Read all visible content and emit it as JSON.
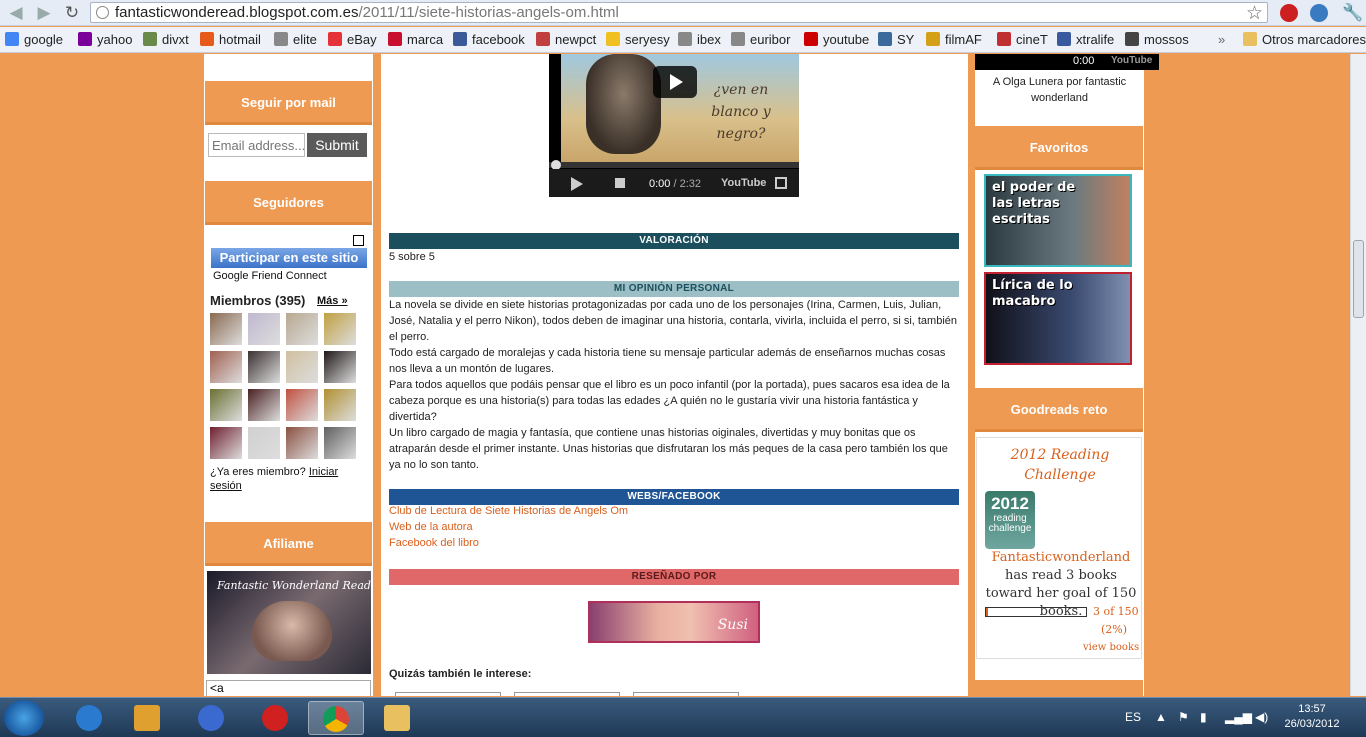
{
  "browser": {
    "url_host": "fantasticwonderead.blogspot.com.es",
    "url_path": "/2011/11/siete-historias-angels-om.html",
    "bookmarks": [
      {
        "label": "google",
        "color": "#4285f4"
      },
      {
        "label": "yahoo",
        "color": "#7b0099"
      },
      {
        "label": "divxt",
        "color": "#6a8a4a"
      },
      {
        "label": "hotmail",
        "color": "#e85a1a"
      },
      {
        "label": "elite",
        "color": "#888888"
      },
      {
        "label": "eBay",
        "color": "#e53238"
      },
      {
        "label": "marca",
        "color": "#c8102e"
      },
      {
        "label": "facebook",
        "color": "#3b5998"
      },
      {
        "label": "newpct",
        "color": "#c04040"
      },
      {
        "label": "seryesy",
        "color": "#f0c020"
      },
      {
        "label": "ibex",
        "color": "#888888"
      },
      {
        "label": "euribor",
        "color": "#888888"
      },
      {
        "label": "youtube",
        "color": "#cc0000"
      },
      {
        "label": "SY",
        "color": "#3a6a9a"
      },
      {
        "label": "filmAF",
        "color": "#d4a017"
      },
      {
        "label": "cineT",
        "color": "#c03030"
      },
      {
        "label": "xtralife",
        "color": "#3a5aa0"
      },
      {
        "label": "mossos",
        "color": "#444444"
      }
    ],
    "other_bookmarks": "Otros marcadores"
  },
  "left": {
    "seguir_title": "Seguir por mail",
    "email_placeholder": "Email address...",
    "submit": "Submit",
    "seguidores_title": "Seguidores",
    "gfc_button": "Participar en este sitio",
    "gfc_caption": "Google Friend Connect",
    "members_label": "Miembros (395)",
    "mas": "Más »",
    "member_question": "¿Ya eres miembro?",
    "login": "Iniciar sesión",
    "afiliame_title": "Afiliame",
    "banner_text": "Fantastic Wonderland Read",
    "textarea_value": "<a",
    "avatar_colors": [
      "#8a6a50",
      "#c0b8d0",
      "#b8a890",
      "#c0a040",
      "#a06050",
      "#3a3030",
      "#d0c0a0",
      "#201818",
      "#6a7030",
      "#4a2020",
      "#c05040",
      "#b09030",
      "#702030",
      "#d0d0d0",
      "#8a5040",
      "#606060"
    ]
  },
  "main": {
    "video_caption": "¿ven en blanco y negro?",
    "video_time": "0:00",
    "video_duration": "/ 2:32",
    "video_logo": "YouTube",
    "valoracion_title": "VALORACIÓN",
    "valoracion_text": "5 sobre 5",
    "opinion_title": "MI OPINIÓN PERSONAL",
    "opinion_p1": "La novela se divide en siete historias protagonizadas por cada uno de los personajes (Irina, Carmen, Luis, Julian, José, Natalia y el perro Nikon), todos deben de imaginar una historia, contarla, vivirla, incluida el perro, si si, también el perro.",
    "opinion_p2": "Todo está cargado de moralejas y cada historia tiene su mensaje particular además de enseñarnos muchas cosas nos lleva a un montón de lugares.",
    "opinion_p3": "Para todos aquellos que podáis pensar que el libro es un poco infantil (por la portada), pues sacaros esa idea de la cabeza porque es una historia(s) para todas las edades ¿A quién no le gustaría vivir una historia fantástica y divertida?",
    "opinion_p4": "Un libro cargado de magia y fantasía, que contiene unas historias oiginales, divertidas y muy bonitas que os atraparán desde el primer instante. Unas historias que disfrutaran los más peques de la casa pero también los que ya no lo son tanto.",
    "webs_title": "WEBS/FACEBOOK",
    "link1": "Club de Lectura de Siete Historias de Angels Om",
    "link2": "Web de la autora",
    "link3": "Facebook del libro",
    "resenado_title": "RESEÑADO POR",
    "susi": "Susi",
    "quizas": "Quizás también le interese:"
  },
  "right": {
    "video_time": "0:00",
    "video_logo": "YouTube",
    "caption": "A Olga Lunera por fantastic wonderland",
    "favoritos_title": "Favoritos",
    "fav1": "el poder de las letras escritas",
    "fav2": "Lírica de lo macabro",
    "goodreads_title": "Goodreads reto",
    "challenge_title": "2012 Reading Challenge",
    "badge_year": "2012",
    "badge_sub": "reading challenge",
    "user": "Fantasticwonderland",
    "text_has": "has read 3 books toward her goal of 150 books.",
    "count": "3 of 150",
    "pct": "(2%)",
    "progress": 0.02,
    "view": "view books"
  },
  "taskbar": {
    "lang": "ES",
    "time": "13:57",
    "date": "26/03/2012"
  }
}
